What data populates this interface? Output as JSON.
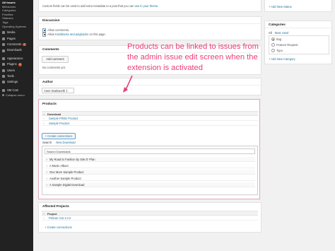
{
  "sidebar": {
    "items": [
      {
        "label": "All Issues"
      },
      {
        "label": "Milestones"
      },
      {
        "label": "Categories"
      },
      {
        "label": "Priorities"
      },
      {
        "label": "Statuses"
      },
      {
        "label": "Tags"
      },
      {
        "label": "Operating Systems"
      },
      {
        "label": "Media"
      },
      {
        "label": "Pages"
      },
      {
        "label": "Comments",
        "badge": "7"
      },
      {
        "label": "Downloads"
      },
      {
        "label": "Appearance"
      },
      {
        "label": "Plugins",
        "badge": "4"
      },
      {
        "label": "Users"
      },
      {
        "label": "Tools"
      },
      {
        "label": "Settings"
      },
      {
        "label": "SM Com"
      },
      {
        "label": "Collapse menu"
      }
    ]
  },
  "custom_fields_note": "Custom fields can be used to add extra metadata to a post that you can",
  "custom_fields_link": "use in your theme",
  "discussion": {
    "title": "Discussion",
    "allow_comments": "Allow comments.",
    "allow_pings_prefix": "Allow",
    "allow_pings_link": "trackbacks and pingbacks",
    "allow_pings_suffix": "on this page."
  },
  "comments": {
    "title": "Comments",
    "add_button": "Add comment",
    "empty": "No comments yet."
  },
  "author": {
    "title": "Author",
    "value": "Anne Dodsworth ‡"
  },
  "annotation": "Products can be linked to issues from the admin issue edit screen when the extension is activated",
  "products": {
    "title": "Products",
    "column": "Download",
    "rows": [
      "Sample FREE Product",
      "Sample Product"
    ],
    "create_connections": "+ Create connections",
    "tabs": [
      "Search",
      "New Download"
    ],
    "search_placeholder": "Search Downloads",
    "results": [
      "My Road to Fashion by Site D' Plan",
      "A Music Album",
      "One More Sample Product",
      "Another Sample Product",
      "A Sample Digital Download"
    ]
  },
  "affected_projects": {
    "title": "Affected Projects",
    "column": "Project",
    "rows": [
      "Pelican Cat 1.0.2"
    ],
    "create_connections": "+ Create connections"
  },
  "right": {
    "add_status": "+ Add New Status",
    "categories_title": "Categories",
    "categories_tabs": [
      "All",
      "Most Used"
    ],
    "categories": [
      {
        "label": "Bug",
        "checked": true
      },
      {
        "label": "Feature Request",
        "checked": false
      },
      {
        "label": "Typo",
        "checked": false
      }
    ],
    "add_category": "+ Add New Category"
  }
}
